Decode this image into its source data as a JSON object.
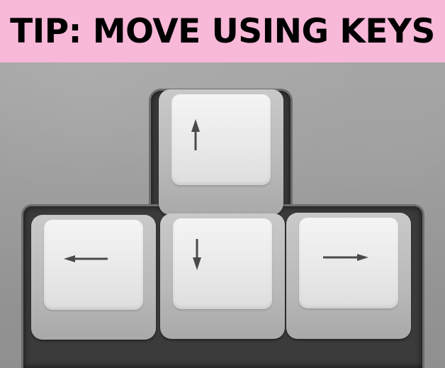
{
  "banner": {
    "text": "TIP: MOVE USING KEYS",
    "background": "#f8b8d8",
    "color": "#000000"
  },
  "keys": [
    {
      "direction": "up",
      "icon": "arrow-up-icon"
    },
    {
      "direction": "left",
      "icon": "arrow-left-icon"
    },
    {
      "direction": "down",
      "icon": "arrow-down-icon"
    },
    {
      "direction": "right",
      "icon": "arrow-right-icon"
    }
  ]
}
